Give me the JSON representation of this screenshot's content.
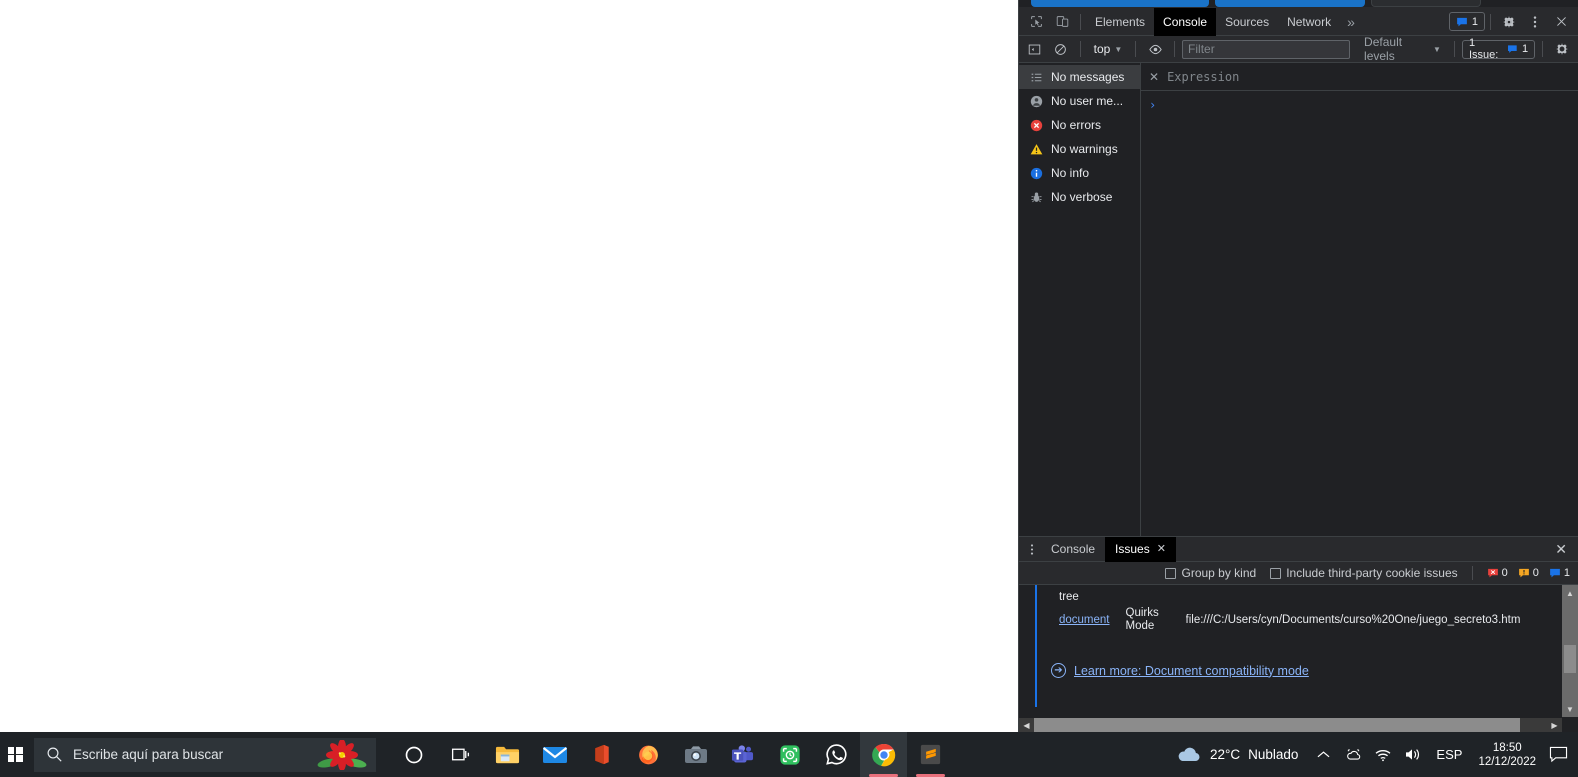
{
  "devtools": {
    "toolbar": {
      "inspect_icon": "inspect-element-icon",
      "device_icon": "device-toolbar-icon",
      "tabs": [
        {
          "label": "Elements",
          "active": false
        },
        {
          "label": "Console",
          "active": true
        },
        {
          "label": "Sources",
          "active": false
        },
        {
          "label": "Network",
          "active": false
        }
      ],
      "more_tabs_label": "»",
      "issues_chip_count": "1",
      "settings_icon": "gear-icon",
      "kebab_icon": "more-options-icon",
      "close_icon": "close-icon"
    },
    "filterbar": {
      "sidebar_toggle_icon": "console-sidebar-toggle-icon",
      "clear_icon": "clear-console-icon",
      "context_label": "top",
      "eye_icon": "live-expression-eye-icon",
      "filter_placeholder": "Filter",
      "filter_value": "",
      "levels_label": "Default levels",
      "issues_button_label": "1 Issue:",
      "issues_button_count": "1",
      "console_settings_icon": "gear-icon"
    },
    "sidebar": [
      {
        "label": "No messages",
        "icon": "list-icon",
        "selected": true
      },
      {
        "label": "No user me...",
        "icon": "user-icon",
        "selected": false
      },
      {
        "label": "No errors",
        "icon": "error-icon",
        "selected": false
      },
      {
        "label": "No warnings",
        "icon": "warning-icon",
        "selected": false
      },
      {
        "label": "No info",
        "icon": "info-icon",
        "selected": false
      },
      {
        "label": "No verbose",
        "icon": "bug-icon",
        "selected": false
      }
    ],
    "eager_eval": {
      "close_icon": "close-expression-icon",
      "placeholder": "Expression"
    },
    "prompt": {
      "caret": "›",
      "value": ""
    },
    "drawer": {
      "kebab_icon": "drawer-more-options-icon",
      "tabs": [
        {
          "label": "Console",
          "active": false,
          "closable": false
        },
        {
          "label": "Issues",
          "active": true,
          "closable": true
        }
      ],
      "close_icon": "close-drawer-icon",
      "toolbar": {
        "group_by_kind_label": "Group by kind",
        "group_by_kind_checked": false,
        "third_party_label": "Include third-party cookie issues",
        "third_party_checked": false,
        "counts": [
          {
            "icon": "error-issue-icon",
            "value": "0",
            "color": "#e33e3e"
          },
          {
            "icon": "warning-issue-icon",
            "value": "0",
            "color": "#f5a623"
          },
          {
            "icon": "info-issue-icon",
            "value": "1",
            "color": "#1a73e8"
          }
        ]
      },
      "issue": {
        "affected_header": "tree",
        "resource_link": "document",
        "mode_label": "Quirks Mode",
        "url": "file:///C:/Users/cyn/Documents/curso%20One/juego_secreto3.htm",
        "learn_more_label": "Learn more: Document compatibility mode",
        "learn_more_icon": "arrow-circle-icon"
      }
    }
  },
  "taskbar": {
    "start_icon": "windows-start-icon",
    "search": {
      "icon": "search-icon",
      "placeholder": "Escribe aquí para buscar",
      "value": "",
      "decoration_icon": "poinsettia-flower-icon"
    },
    "apps": [
      {
        "name": "cortana-icon",
        "active": false,
        "running": false
      },
      {
        "name": "task-view-icon",
        "active": false,
        "running": false
      },
      {
        "name": "file-explorer-icon",
        "active": false,
        "running": false
      },
      {
        "name": "mail-icon",
        "active": false,
        "running": false
      },
      {
        "name": "office-icon",
        "active": false,
        "running": false
      },
      {
        "name": "firefox-icon",
        "active": false,
        "running": false
      },
      {
        "name": "camera-icon",
        "active": false,
        "running": false
      },
      {
        "name": "microsoft-teams-icon",
        "active": false,
        "running": false
      },
      {
        "name": "screen-recorder-icon",
        "active": false,
        "running": false
      },
      {
        "name": "whatsapp-icon",
        "active": false,
        "running": false
      },
      {
        "name": "google-chrome-icon",
        "active": true,
        "running": true
      },
      {
        "name": "sublime-text-icon",
        "active": false,
        "running": true
      }
    ],
    "tray": {
      "weather_icon": "cloud-icon",
      "temperature": "22°C",
      "condition": "Nublado",
      "show_hidden_icon": "chevron-up-icon",
      "onedrive_icon": "onedrive-icon",
      "network_icon": "wifi-icon",
      "volume_icon": "speaker-icon",
      "language": "ESP",
      "time": "18:50",
      "date": "12/12/2022",
      "action_center_icon": "notification-icon"
    }
  },
  "colors": {
    "devtools_bg": "#202124",
    "toolbar_bg": "#292a2d",
    "accent_blue": "#1a73e8",
    "link_blue": "#8ab4f8",
    "taskbar_bg": "#1f2327",
    "error_red": "#e33e3e",
    "warning_yellow": "#f5bb00"
  }
}
